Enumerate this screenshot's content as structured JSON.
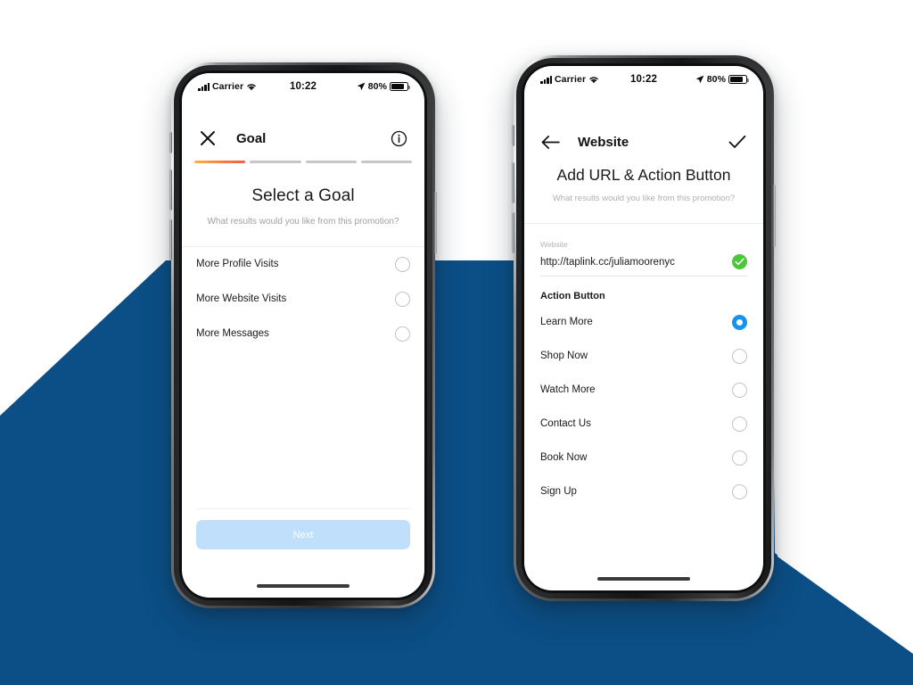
{
  "background": {
    "page_color": "#ffffff",
    "accent_color": "#0b4f86"
  },
  "phones": [
    {
      "id": "goal-screen",
      "status_bar": {
        "carrier": "Carrier",
        "time": "10:22",
        "battery_percent": "80%",
        "location_icon": "location-arrow-icon",
        "wifi_icon": "wifi-icon",
        "signal_icon": "signal-bars-icon",
        "battery_icon": "battery-icon"
      },
      "navbar": {
        "close_icon": "close-icon",
        "title": "Goal",
        "info_icon": "info-circle-icon"
      },
      "progress": {
        "total_steps": 4,
        "active_step": 1,
        "active_color": "#f57a45",
        "inactive_color": "#c7c7c7"
      },
      "hero": {
        "title": "Select a Goal",
        "subtitle": "What results would you like from this promotion?"
      },
      "options": [
        {
          "label": "More Profile Visits",
          "selected": false
        },
        {
          "label": "More Website Visits",
          "selected": false
        },
        {
          "label": "More Messages",
          "selected": false
        }
      ],
      "cta": {
        "label": "Next",
        "enabled": false,
        "color": "#bfdffa"
      }
    },
    {
      "id": "website-screen",
      "status_bar": {
        "carrier": "Carrier",
        "time": "10:22",
        "battery_percent": "80%",
        "location_icon": "location-arrow-icon",
        "wifi_icon": "wifi-icon",
        "signal_icon": "signal-bars-icon",
        "battery_icon": "battery-icon"
      },
      "navbar": {
        "back_icon": "arrow-left-icon",
        "title": "Website",
        "confirm_icon": "checkmark-icon"
      },
      "hero": {
        "title": "Add URL & Action Button",
        "subtitle": "What results would you like from this promotion?"
      },
      "url_field": {
        "label": "Website",
        "value": "http://taplink.cc/juliamoorenyc",
        "placeholder": "http://",
        "valid": true,
        "valid_icon": "check-circle-icon",
        "valid_color": "#4cc63c"
      },
      "section_title": "Action Button",
      "options": [
        {
          "label": "Learn More",
          "selected": true
        },
        {
          "label": "Shop Now",
          "selected": false
        },
        {
          "label": "Watch More",
          "selected": false
        },
        {
          "label": "Contact Us",
          "selected": false
        },
        {
          "label": "Book Now",
          "selected": false
        },
        {
          "label": "Sign Up",
          "selected": false
        }
      ],
      "selected_color": "#1593f5"
    }
  ]
}
